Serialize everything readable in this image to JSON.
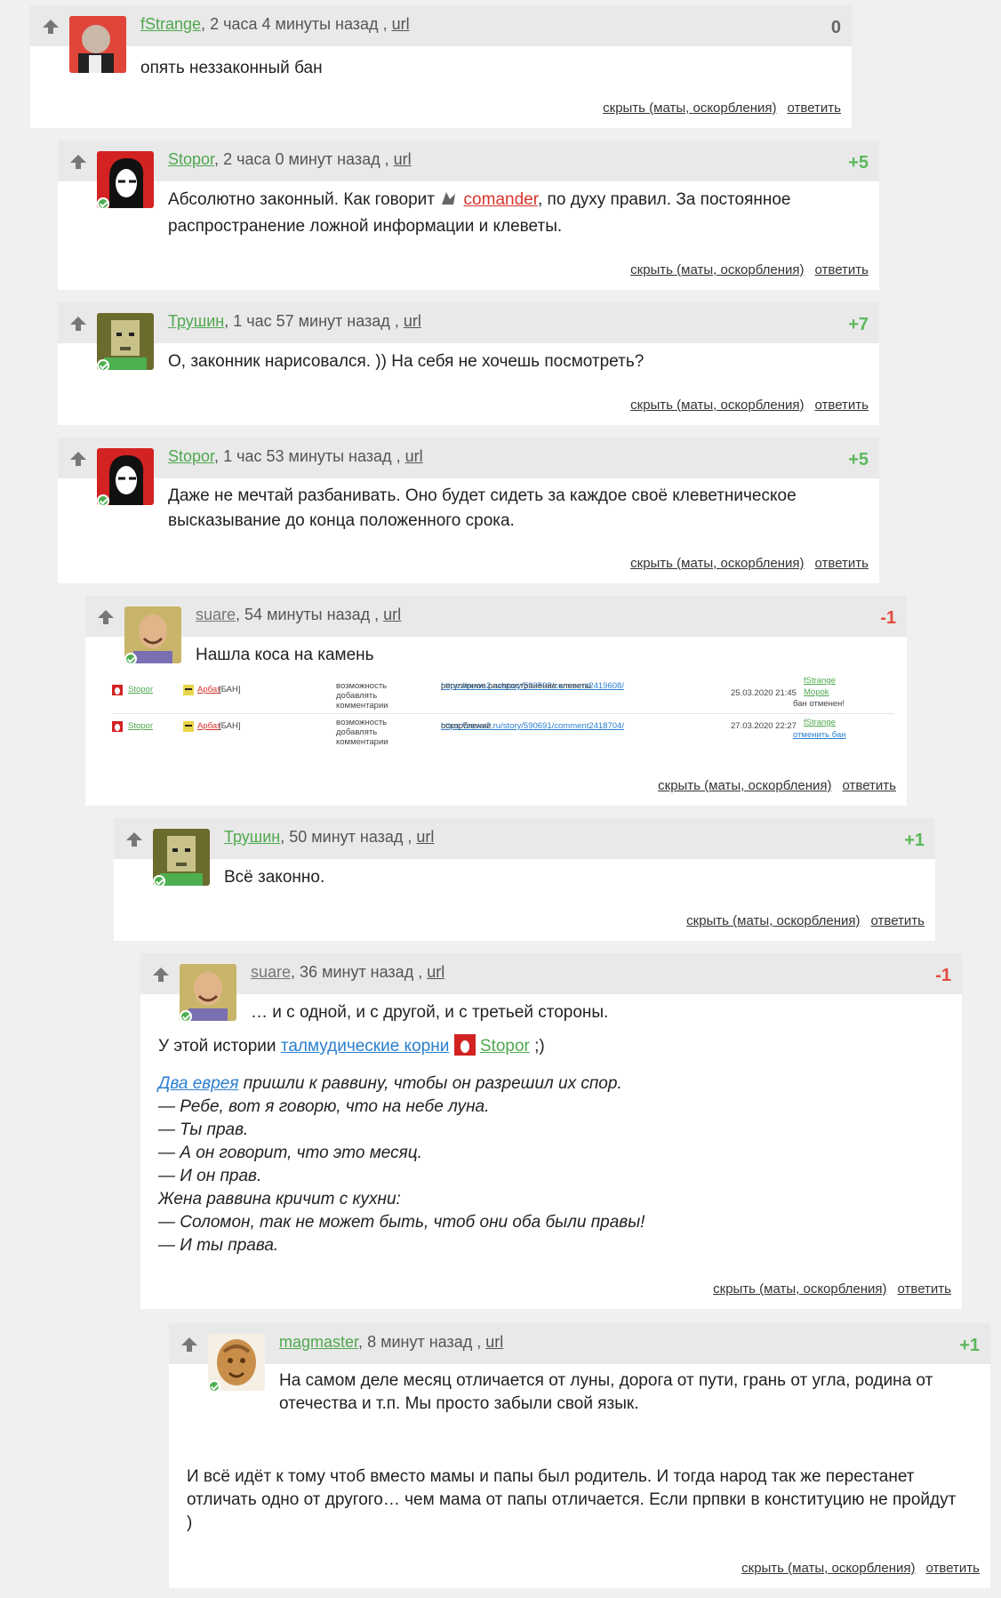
{
  "actions": {
    "hide": "скрыть (маты, оскорбления)",
    "reply": "ответить"
  },
  "comments": [
    {
      "user": "fStrange",
      "time": "2 часа 4 минуты назад",
      "url": "url",
      "score": "0",
      "text": [
        "опять неззаконный бан"
      ]
    },
    {
      "user": "Stopor",
      "time": "2 часа 0 минут назад",
      "url": "url",
      "score": "+5",
      "text_parts": [
        "Абсолютно законный. Как говорит",
        "comander",
        ", по духу правил. За постоянное"
      ],
      "text2": "распространение ложной информации и клеветы."
    },
    {
      "user": "Трушин",
      "time": "1 час 57 минут назад",
      "url": "url",
      "score": "+7",
      "text": [
        "О, законник нарисовался. ))  На себя не хочешь посмотреть?"
      ]
    },
    {
      "user": "Stopor",
      "time": "1 час 53 минуты назад",
      "url": "url",
      "score": "+5",
      "text": [
        "Даже не мечтай разбанивать. Оно будет сидеть за каждое своё клеветническое",
        "высказывание до конца положенного срока."
      ]
    },
    {
      "user": "suare",
      "time": "54 минуты назад",
      "url": "url",
      "score": "-1",
      "text": [
        "Нашла коса на камень"
      ],
      "ban_rows": [
        {
          "who": "Stopor",
          "target": "Арбат",
          "tag": "[БАН]",
          "action": "возможность добавлять комментарии",
          "link": "https://news2.ru/story/593598/comment2419608/",
          "reason": "регулярное распространение клеветы",
          "date": "25.03.2020 21:45",
          "mods": [
            "fStrange",
            "Mopok"
          ],
          "note": "бан отменен!"
        },
        {
          "who": "Stopor",
          "target": "Арбат",
          "tag": "[БАН]",
          "action": "возможность добавлять комментарии",
          "link": "https://news2.ru/story/590691/comment2418704/",
          "reason": "оскорбление",
          "date": "27.03.2020 22:27",
          "mods": [
            "fStrange"
          ],
          "note": "отменить бан"
        }
      ]
    },
    {
      "user": "Трушин",
      "time": "50 минут назад",
      "url": "url",
      "score": "+1",
      "text": [
        "Всё законно."
      ]
    },
    {
      "user": "suare",
      "time": "36 минут назад",
      "url": "url",
      "score": "-1",
      "line1": "… и с одной, и с другой, и с третьей стороны.",
      "line2_pre": "У этой истории",
      "line2_link": "талмудические корни",
      "line2_user": "Stopor",
      "line2_post": ";)",
      "joke_link": "Два еврея",
      "joke_first": "пришли к раввину, чтобы он разрешил их спор.",
      "joke": [
        "— Ребе, вот я говорю, что на небе луна.",
        "— Ты прав.",
        "— А он говорит, что это месяц.",
        "— И он прав.",
        "Жена раввина кричит с кухни:",
        "— Соломон, так не может быть, чтоб они оба были правы!",
        "— И ты права."
      ]
    },
    {
      "user": "magmaster",
      "time": "8 минут назад",
      "url": "url",
      "score": "+1",
      "text": [
        "На самом деле месяц отличается от луны, дорога от пути, грань от угла, родина от",
        "отечества и т.п. Мы просто забыли свой язык."
      ],
      "text_b": [
        "И всё идёт к тому чтоб вместо мамы и папы был родитель. И тогда народ так же перестанет",
        "отличать одно от другого… чем мама от папы отличается. Если прпвки в конституцию не пройдут",
        ")"
      ]
    }
  ]
}
